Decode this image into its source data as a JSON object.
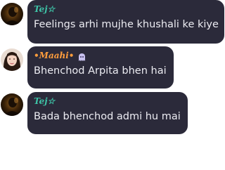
{
  "messages": [
    {
      "author": "Tej☆",
      "text": "Feelings arhi mujhe khushali ke kiye",
      "name_color": "#3ec3a7",
      "avatar": "dark-silhouette-avatar"
    },
    {
      "author": "•Maahi•",
      "text": "Bhenchod Arpita bhen hai",
      "name_color": "#ff9d3c",
      "avatar": "girl-photo-avatar",
      "badge_icon": "ghost-icon"
    },
    {
      "author": "Tej☆",
      "text": "Bada bhenchod admi hu mai",
      "name_color": "#3ec3a7",
      "avatar": "dark-silhouette-avatar"
    }
  ],
  "colors": {
    "bubble_bg": "#2b2a3a",
    "message_text": "#ececf2",
    "page_bg": "#ffffff"
  }
}
